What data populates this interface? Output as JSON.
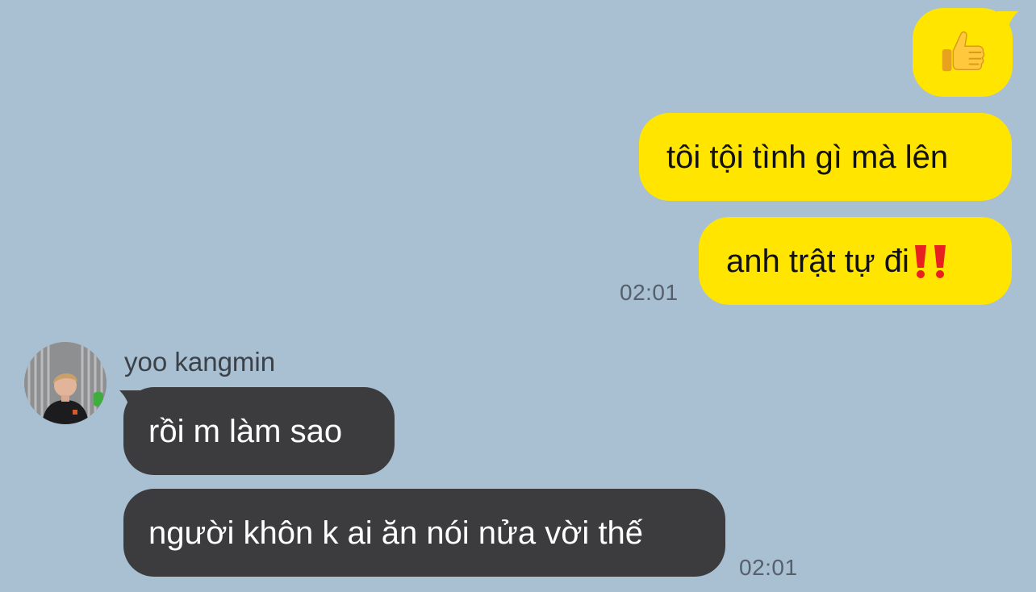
{
  "colors": {
    "background": "#a9bfd2",
    "outgoing_bubble": "#ffe500",
    "incoming_bubble": "#3c3c3e",
    "timestamp": "#55606c"
  },
  "outgoing": {
    "messages": [
      {
        "type": "emoji",
        "icon": "thumbs-up-icon"
      },
      {
        "type": "text",
        "text": "tôi tội tình gì mà lên"
      },
      {
        "type": "text",
        "text": "anh trật tự đi",
        "trailing_icon": "double-exclamation-icon"
      }
    ],
    "time": "02:01"
  },
  "incoming": {
    "sender": "yoo kangmin",
    "avatar_icon": "avatar",
    "messages": [
      {
        "text": "rồi m làm sao"
      },
      {
        "text": "người khôn k ai ăn nói nửa vời thế"
      }
    ],
    "time": "02:01"
  }
}
